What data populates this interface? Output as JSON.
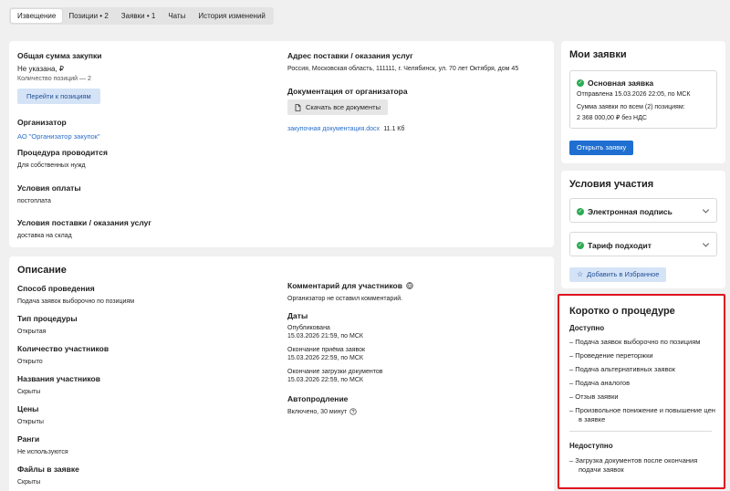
{
  "tabs": [
    {
      "label": "Извещение",
      "active": true
    },
    {
      "label": "Позиции • 2"
    },
    {
      "label": "Заявки • 1"
    },
    {
      "label": "Чаты"
    },
    {
      "label": "История изменений"
    }
  ],
  "summary": {
    "total_title": "Общая сумма закупки",
    "total_value": "Не указана, ₽",
    "positions_count": "Количество позиций — 2",
    "go_positions_button": "Перейти к позициям",
    "organizer_title": "Организатор",
    "organizer_link": "АО \"Организатор закупок\"",
    "procedure_title": "Процедура проводится",
    "procedure_value": "Для собственных нужд",
    "payment_title": "Условия оплаты",
    "payment_value": "постоплата",
    "delivery_title": "Условия поставки / оказания услуг",
    "delivery_value": "доставка на склад",
    "address_title": "Адрес поставки / оказания услуг",
    "address_value": "Россия, Московская область, 111111, г. Челябинск, ул. 70 лет Октября, дом 45",
    "docs_title": "Документация от организатора",
    "download_all_button": "Скачать все документы",
    "doc_file_link": "закупочная документация.docx",
    "doc_file_size": "11.1 Кб"
  },
  "description": {
    "title": "Описание",
    "left": [
      {
        "label": "Способ проведения",
        "value": "Подача заявок выборочно по позициям"
      },
      {
        "label": "Тип процедуры",
        "value": "Открытая"
      },
      {
        "label": "Количество участников",
        "value": "Открыто"
      },
      {
        "label": "Названия участников",
        "value": "Скрыты"
      },
      {
        "label": "Цены",
        "value": "Открыты"
      },
      {
        "label": "Ранги",
        "value": "Не используются"
      },
      {
        "label": "Файлы в заявке",
        "value": "Скрыты"
      }
    ],
    "comments_title": "Комментарий для участников",
    "comments_value": "Организатор не оставил комментарий.",
    "dates_title": "Даты",
    "dates": [
      {
        "label": "Опубликована",
        "value": "15.03.2026 21:59, по МСК"
      },
      {
        "label": "Окончание приёма заявок",
        "value": "15.03.2026 22:59, по МСК"
      },
      {
        "label": "Окончание загрузки документов",
        "value": "15.03.2026 22:59, по МСК"
      }
    ],
    "autoext_title": "Автопродление",
    "autoext_value": "Включено, 30 минут"
  },
  "my_bids": {
    "title": "Мои заявки",
    "main_bid_title": "Основная заявка",
    "sent": "Отправлена 15.03.2026 22:05, по МСК",
    "sum_label": "Сумма заявки по всем (2) позициям:",
    "sum_value": "2 368 000,00 ₽  без НДС",
    "open_button": "Открыть заявку"
  },
  "conditions": {
    "title": "Условия участия",
    "items": [
      {
        "label": "Электронная подпись"
      },
      {
        "label": "Тариф подходит"
      }
    ],
    "favorite_button": "Добавить в Избранное"
  },
  "brief": {
    "title": "Коротко о процедуре",
    "available_title": "Доступно",
    "available": [
      "Подача заявок выборочно по позициям",
      "Проведение переторжки",
      "Подача альтернативных заявок",
      "Подача аналогов",
      "Отзыв заявки",
      "Произвольное понижение и повышение цен в заявке"
    ],
    "unavailable_title": "Недоступно",
    "unavailable": [
      "Загрузка документов после окончания подачи заявок"
    ]
  },
  "colors": {
    "accent": "#1f6fd1",
    "link": "#2a6fc9",
    "success": "#2bab52",
    "highlight_border": "#e0141e"
  }
}
